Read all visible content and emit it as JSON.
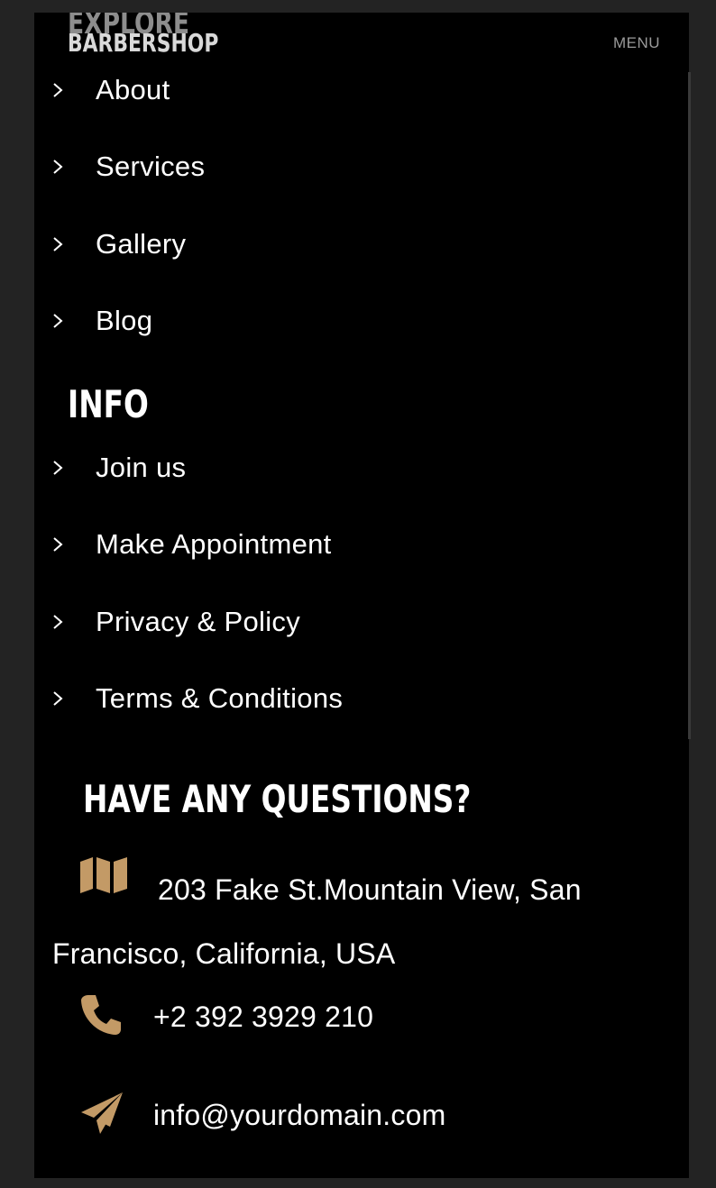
{
  "header": {
    "logo_line1": "EXPLORE",
    "logo_line2": "BARBERSHOP",
    "menu_label": "MENU"
  },
  "explore_nav": [
    {
      "label": "About"
    },
    {
      "label": "Services"
    },
    {
      "label": "Gallery"
    },
    {
      "label": "Blog"
    }
  ],
  "info": {
    "title": "INFO",
    "items": [
      {
        "label": "Join us"
      },
      {
        "label": "Make Appointment"
      },
      {
        "label": "Privacy & Policy"
      },
      {
        "label": "Terms & Conditions"
      }
    ]
  },
  "contact": {
    "title": "HAVE ANY QUESTIONS?",
    "address": "203 Fake St.Mountain View, San Francisco, California, USA",
    "phone": "+2 392 3929 210",
    "email": "info@yourdomain.com",
    "icons": {
      "address": "map-icon",
      "phone": "phone-icon",
      "email": "paper-plane-icon"
    }
  },
  "colors": {
    "background": "#000000",
    "page_bg": "#232323",
    "accent": "#c39a66",
    "text": "#ffffff"
  }
}
